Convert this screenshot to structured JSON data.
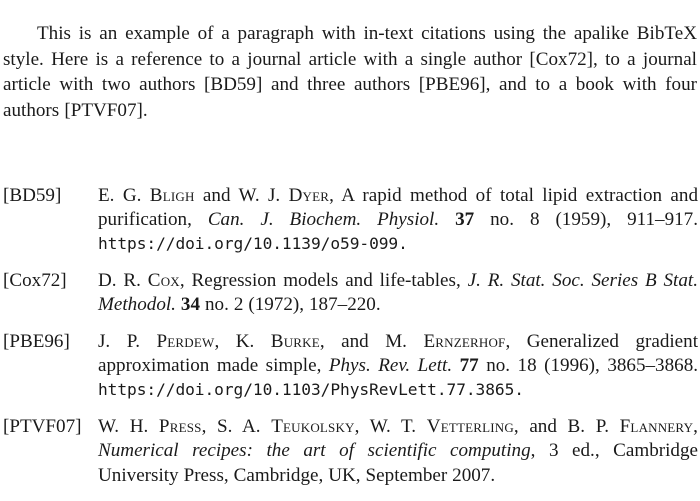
{
  "document": {
    "type": "bibliography-example",
    "intro_paragraph": {
      "text": "This is an example of a paragraph with in-text citations using the apalike BibTeX style. Here is a reference to a journal article with a single author [Cox72], to a journal article with two authors [BD59] and three authors [PBE96], and to a book with four authors [PTVF07].",
      "inline_citations": [
        "[Cox72]",
        "[BD59]",
        "[PBE96]",
        "[PTVF07]"
      ],
      "bibtex_style": "apalike"
    },
    "bibliography": [
      {
        "label": "[BD59]",
        "key": "BD59",
        "authors_plain": "E. G. Bligh and W. J. Dyer",
        "author_parts": [
          {
            "initials": "E. G. ",
            "surname": "Bligh"
          },
          {
            "conjunction": " and "
          },
          {
            "initials": "W. J. ",
            "surname": "Dyer"
          }
        ],
        "title": "A rapid method of total lipid extraction and purification",
        "journal": "Can. J. Biochem. Physiol.",
        "volume": "37",
        "number_label": "no. 8",
        "year": "(1959)",
        "pages": "911–917.",
        "doi_url": "https://doi.org/10.1139/o59-099",
        "doi_trailing": "."
      },
      {
        "label": "[Cox72]",
        "key": "Cox72",
        "authors_plain": "D. R. Cox",
        "author_parts": [
          {
            "initials": "D. R. ",
            "surname": "Cox"
          }
        ],
        "title": "Regression models and life-tables",
        "journal": "J. R. Stat. Soc. Series B Stat. Methodol.",
        "volume": "34",
        "number_label": "no. 2",
        "year": "(1972)",
        "pages": "187–220.",
        "doi_url": "",
        "doi_trailing": ""
      },
      {
        "label": "[PBE96]",
        "key": "PBE96",
        "authors_plain": "J. P. Perdew, K. Burke, and M. Ernzerhof",
        "author_parts": [
          {
            "initials": "J. P. ",
            "surname": "Perdew"
          },
          {
            "conjunction": ", "
          },
          {
            "initials": "K. ",
            "surname": "Burke"
          },
          {
            "conjunction": ", and "
          },
          {
            "initials": "M. ",
            "surname": "Ernzerhof"
          }
        ],
        "title": "Generalized gradient approximation made simple",
        "journal": "Phys. Rev. Lett.",
        "volume": "77",
        "number_label": "no. 18",
        "year": "(1996)",
        "pages": "3865–3868.",
        "doi_url": "https://doi.org/10.1103/PhysRevLett.77.3865",
        "doi_trailing": "."
      },
      {
        "label": "[PTVF07]",
        "key": "PTVF07",
        "authors_plain": "W. H. Press, S. A. Teukolsky, W. T. Vetterling, and B. P. Flannery",
        "author_parts": [
          {
            "initials": "W. H. ",
            "surname": "Press"
          },
          {
            "conjunction": ", "
          },
          {
            "initials": "S. A. ",
            "surname": "Teukolsky"
          },
          {
            "conjunction": ", "
          },
          {
            "initials": "W. T. ",
            "surname": "Vetterling"
          },
          {
            "conjunction": ", and "
          },
          {
            "initials": "B. P. ",
            "surname": "Flannery"
          }
        ],
        "title": "Numerical recipes: the art of scientific computing",
        "edition": "3 ed.",
        "publisher": "Cambridge University Press",
        "address": "Cambridge, UK",
        "date": "September 2007.",
        "doi_url": "",
        "doi_trailing": ""
      }
    ]
  },
  "entry_bd59": {
    "label": "[BD59]",
    "a1_initials": "E. G. ",
    "a1_surname": "Bligh",
    "conj1": " and ",
    "a2_initials": "W. J. ",
    "a2_surname": "Dyer",
    "sep1": ", ",
    "title": "A rapid method of total lipid extraction and purification",
    "sep2": ", ",
    "journal": "Can. J. Biochem. Physiol.",
    "volume": "37",
    "issue": "no. 8",
    "year": "(1959)",
    "sep3": ", ",
    "pages": "911–917.",
    "doi": "https://doi.org/10.1139/o59-099",
    "period": "."
  },
  "entry_cox72": {
    "label": "[Cox72]",
    "a1_initials": "D. R. ",
    "a1_surname": "Cox",
    "sep1": ", ",
    "title": "Regression models and life-tables",
    "sep2": ", ",
    "journal": "J. R. Stat. Soc. Series B Stat. Methodol.",
    "volume": "34",
    "issue": "no. 2",
    "year": "(1972)",
    "sep3": ", ",
    "pages": "187–220."
  },
  "entry_pbe96": {
    "label": "[PBE96]",
    "a1_initials": "J. P. ",
    "a1_surname": "Perdew",
    "conj1": ", ",
    "a2_initials": "K. ",
    "a2_surname": "Burke",
    "conj2": ", and ",
    "a3_initials": "M. ",
    "a3_surname": "Ernzerhof",
    "sep1": ", ",
    "title": "Generalized gradient approximation made simple",
    "sep2": ", ",
    "journal": "Phys. Rev. Lett.",
    "volume": "77",
    "issue": "no. 18",
    "year": "(1996)",
    "sep3": ", ",
    "pages": "3865–3868.",
    "doi": "https://doi.org/10.1103/PhysRevLett.77.3865",
    "period": "."
  },
  "entry_ptvf07": {
    "label": "[PTVF07]",
    "a1_initials": "W. H. ",
    "a1_surname": "Press",
    "conj1": ", ",
    "a2_initials": "S. A. ",
    "a2_surname": "Teukolsky",
    "conj2": ", ",
    "a3_initials": "W. T. ",
    "a3_surname": "Vetterling",
    "conj3": ", and ",
    "a4_initials": "B. P. ",
    "a4_surname": "Flannery",
    "sep1": ", ",
    "title": "Numerical recipes: the art of scientific computing",
    "sep2": ", ",
    "edition": "3 ed.",
    "sep3": ", ",
    "publisher": "Cambridge University Press",
    "sep4": ", ",
    "address": "Cambridge, UK",
    "sep5": ", ",
    "date": "September 2007."
  },
  "intro": {
    "text": "This is an example of a paragraph with in-text citations using the apalike BibTeX style. Here is a reference to a journal article with a single author [Cox72], to a journal article with two authors [BD59] and three authors [PBE96], and to a book with four authors [PTVF07]."
  },
  "colors": {
    "page_background": "#ffffff",
    "text": "#1a1a1a"
  }
}
